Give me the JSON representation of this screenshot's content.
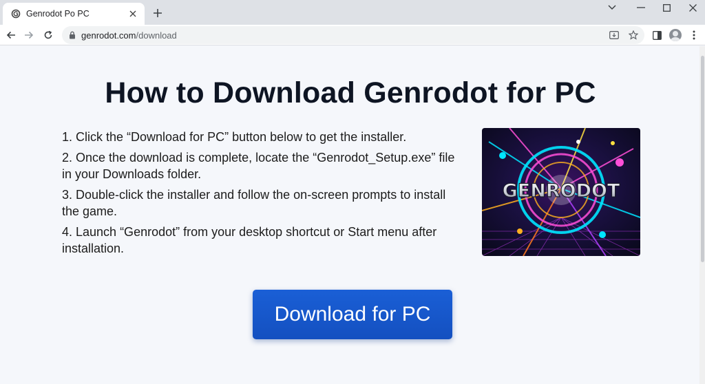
{
  "browser": {
    "tab": {
      "title": "Genrodot Po PC",
      "favicon": "genrodot-favicon"
    },
    "url": {
      "host": "genrodot.com",
      "path": "/download"
    },
    "icons": [
      "back-icon",
      "forward-icon",
      "reload-icon",
      "lock-icon",
      "install-app-icon",
      "bookmark-star-icon",
      "side-panel-icon",
      "profile-avatar",
      "menu-kebab-icon",
      "minimize-icon",
      "maximize-icon",
      "close-window-icon",
      "tab-search-icon",
      "new-tab-icon"
    ]
  },
  "page": {
    "title": "How to Download Genrodot for PC",
    "steps": [
      "1. Click the “Download for PC” button below to get the installer.",
      "2. Once the download is complete, locate the “Genrodot_Setup.exe” file in your Downloads folder.",
      "3. Double-click the installer and follow the on-screen prompts to install the game.",
      "4. Launch “Genrodot” from your desktop shortcut or Start menu after installation."
    ],
    "game_art_logo": "GENRODOT",
    "download_button": "Download for PC"
  },
  "colors": {
    "accent": "#1a5fd6",
    "page_background": "#f5f7fb",
    "title": "#0e1523"
  }
}
